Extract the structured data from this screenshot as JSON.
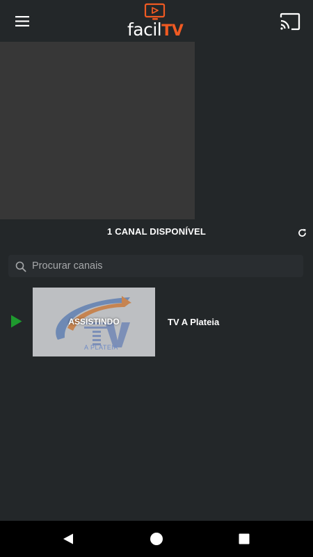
{
  "app": {
    "logo_text_white": "facil",
    "logo_text_orange": "TV",
    "brand_color": "#f05a22"
  },
  "header": {
    "menu_icon": "hamburger-menu-icon",
    "cast_icon": "cast-icon"
  },
  "channels": {
    "count_label": "1 CANAL DISPONÍVEL",
    "refresh_icon": "refresh-icon"
  },
  "search": {
    "placeholder": "Procurar canais",
    "value": ""
  },
  "channel_list": [
    {
      "name": "TV A Plateia",
      "status_label": "ASSISTINDO",
      "thumbnail_logo_text": "TV",
      "thumbnail_logo_subtext": "A PLATEIA",
      "playing": true,
      "indicator_color": "#1e9a2e"
    }
  ],
  "system_nav": {
    "back_icon": "back-triangle-icon",
    "home_icon": "home-circle-icon",
    "recents_icon": "recents-square-icon"
  }
}
